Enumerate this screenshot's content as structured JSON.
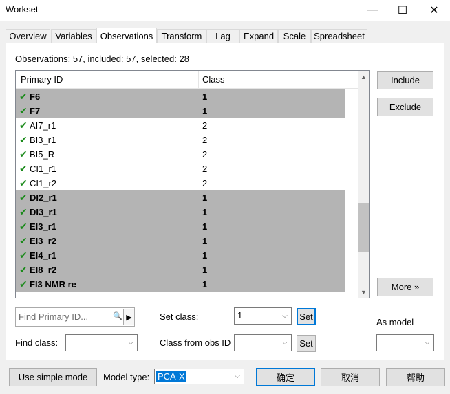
{
  "window": {
    "title": "Workset",
    "minimize_glyph": "—",
    "maximize_glyph": "☐",
    "close_glyph": "✕"
  },
  "tabs": [
    {
      "label": "Overview",
      "active": false
    },
    {
      "label": "Variables",
      "active": false
    },
    {
      "label": "Observations",
      "active": true
    },
    {
      "label": "Transform",
      "active": false
    },
    {
      "label": "Lag",
      "active": false
    },
    {
      "label": "Expand",
      "active": false
    },
    {
      "label": "Scale",
      "active": false
    },
    {
      "label": "Spreadsheet",
      "active": false
    }
  ],
  "summary": "Observations: 57, included: 57, selected: 28",
  "list": {
    "columns": {
      "id": "Primary ID",
      "class": "Class"
    },
    "check_glyph": "✔",
    "rows": [
      {
        "id": "F6",
        "class": "1",
        "selected": true
      },
      {
        "id": "F7",
        "class": "1",
        "selected": true
      },
      {
        "id": "AI7_r1",
        "class": "2",
        "selected": false
      },
      {
        "id": "BI3_r1",
        "class": "2",
        "selected": false
      },
      {
        "id": "BI5_R",
        "class": "2",
        "selected": false
      },
      {
        "id": "CI1_r1",
        "class": "2",
        "selected": false
      },
      {
        "id": "CI1_r2",
        "class": "2",
        "selected": false
      },
      {
        "id": "DI2_r1",
        "class": "1",
        "selected": true
      },
      {
        "id": "DI3_r1",
        "class": "1",
        "selected": true
      },
      {
        "id": "EI3_r1",
        "class": "1",
        "selected": true
      },
      {
        "id": "EI3_r2",
        "class": "1",
        "selected": true
      },
      {
        "id": "EI4_r1",
        "class": "1",
        "selected": true
      },
      {
        "id": "EI8_r2",
        "class": "1",
        "selected": true
      },
      {
        "id": "FI3 NMR re",
        "class": "1",
        "selected": true
      }
    ],
    "scroll_position": 0.78
  },
  "side_buttons": {
    "include": "Include",
    "exclude": "Exclude",
    "more": "More »"
  },
  "find": {
    "placeholder": "Find Primary ID...",
    "search_glyph": "🔍",
    "go_glyph": "▶",
    "find_class_label": "Find class:",
    "find_class_value": ""
  },
  "set_class": {
    "label": "Set class:",
    "value": "1",
    "button": "Set"
  },
  "class_from_obs": {
    "label": "Class from obs ID",
    "value": "",
    "button": "Set"
  },
  "as_model": {
    "label": "As model",
    "value": ""
  },
  "footer": {
    "simple_mode": "Use simple mode",
    "model_type_label": "Model type:",
    "model_type_value": "PCA-X",
    "ok": "确定",
    "cancel": "取消",
    "help": "帮助"
  },
  "dropdown_glyph": "⌵"
}
